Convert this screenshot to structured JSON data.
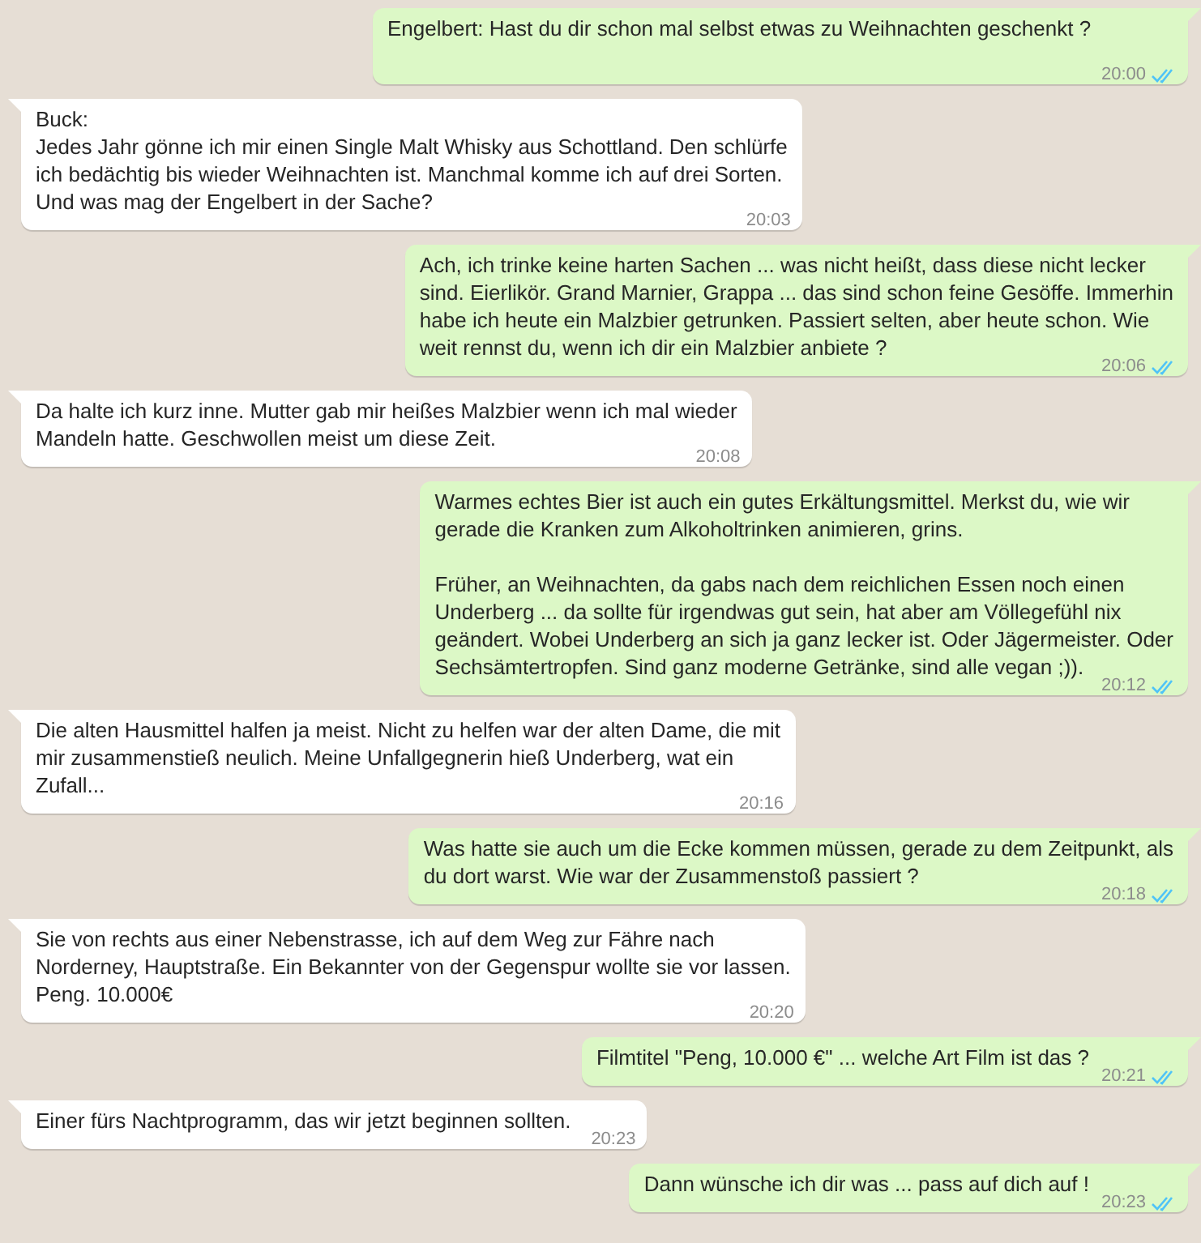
{
  "messages": [
    {
      "kind": "out",
      "text": "Engelbert: Hast du dir schon mal selbst etwas zu Weihnachten geschenkt ?",
      "time": "20:00",
      "read": true
    },
    {
      "kind": "in",
      "text": "Buck:\nJedes Jahr gönne ich mir einen Single Malt Whisky aus Schottland. Den schlürfe\nich bedächtig bis wieder Weihnachten ist. Manchmal komme ich auf drei Sorten.\nUnd was mag der Engelbert in der Sache?",
      "time": "20:03"
    },
    {
      "kind": "out",
      "text": "Ach, ich trinke keine harten Sachen ... was nicht heißt, dass diese nicht lecker\nsind. Eierlikör. Grand Marnier, Grappa ... das sind schon feine Gesöffe. Immerhin\nhabe ich heute ein Malzbier getrunken. Passiert selten, aber heute schon. Wie\nweit rennst du, wenn ich dir ein Malzbier anbiete ?",
      "time": "20:06",
      "read": true
    },
    {
      "kind": "in",
      "text": "Da halte ich kurz inne. Mutter gab mir heißes Malzbier wenn ich mal wieder\nMandeln hatte. Geschwollen meist um diese Zeit.",
      "time": "20:08"
    },
    {
      "kind": "out",
      "text": "Warmes echtes Bier ist auch ein gutes Erkältungsmittel. Merkst du, wie wir\ngerade die Kranken zum Alkoholtrinken animieren, grins.\n\nFrüher, an Weihnachten, da gabs nach dem reichlichen Essen noch einen\nUnderberg ... da sollte für irgendwas gut sein, hat aber am Völlegefühl nix\ngeändert. Wobei Underberg an sich ja ganz lecker ist. Oder Jägermeister. Oder\nSechsämtertropfen. Sind ganz moderne Getränke, sind alle vegan ;)).",
      "time": "20:12",
      "read": true
    },
    {
      "kind": "in",
      "text": "Die alten Hausmittel halfen ja meist. Nicht zu helfen war der alten Dame, die mit\nmir zusammenstieß neulich. Meine Unfallgegnerin hieß Underberg, wat ein\nZufall...",
      "time": "20:16"
    },
    {
      "kind": "out",
      "text": "Was hatte sie auch um die Ecke kommen müssen, gerade zu dem Zeitpunkt, als\ndu dort warst. Wie war der Zusammenstoß passiert ?",
      "time": "20:18",
      "read": true
    },
    {
      "kind": "in",
      "text": "Sie von rechts aus einer Nebenstrasse, ich auf dem Weg zur Fähre nach\nNorderney, Hauptstraße. Ein Bekannter von der Gegenspur wollte sie vor lassen.\nPeng. 10.000€",
      "time": "20:20"
    },
    {
      "kind": "out",
      "text": "Filmtitel \"Peng, 10.000 €\" ... welche Art Film ist das ?",
      "time": "20:21",
      "read": true
    },
    {
      "kind": "in",
      "text": "Einer fürs Nachtprogramm, das wir jetzt beginnen sollten.",
      "time": "20:23"
    },
    {
      "kind": "out",
      "text": "Dann wünsche ich dir was ... pass auf dich auf !",
      "time": "20:23",
      "read": true
    }
  ]
}
